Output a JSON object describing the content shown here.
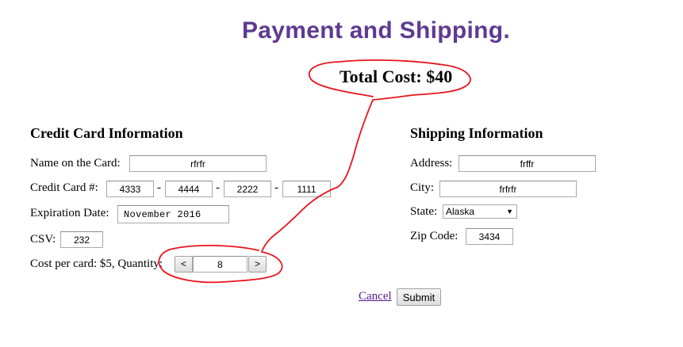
{
  "header": {
    "title": "Payment and Shipping.",
    "total_cost": "Total Cost: $40"
  },
  "credit_card": {
    "section_title": "Credit Card Information",
    "name_label": "Name on the Card:",
    "name_value": "rfrfr",
    "number_label": "Credit Card #:",
    "number_parts": [
      "4333",
      "4444",
      "2222",
      "1111"
    ],
    "dash": "-",
    "expiration_label": "Expiration Date:",
    "expiration_value": "November 2016",
    "csv_label": "CSV:",
    "csv_value": "232",
    "quantity_label": "Cost per card: $5, Quantity:",
    "decrement_label": "<",
    "quantity_value": "8",
    "increment_label": ">"
  },
  "shipping": {
    "section_title": "Shipping Information",
    "address_label": "Address:",
    "address_value": "frffr",
    "city_label": "City:",
    "city_value": "frfrfr",
    "state_label": "State:",
    "state_value": "Alaska",
    "zip_label": "Zip Code:",
    "zip_value": "3434"
  },
  "actions": {
    "cancel_label": "Cancel",
    "submit_label": "Submit"
  },
  "annotation": {
    "color": "#e8151b"
  }
}
